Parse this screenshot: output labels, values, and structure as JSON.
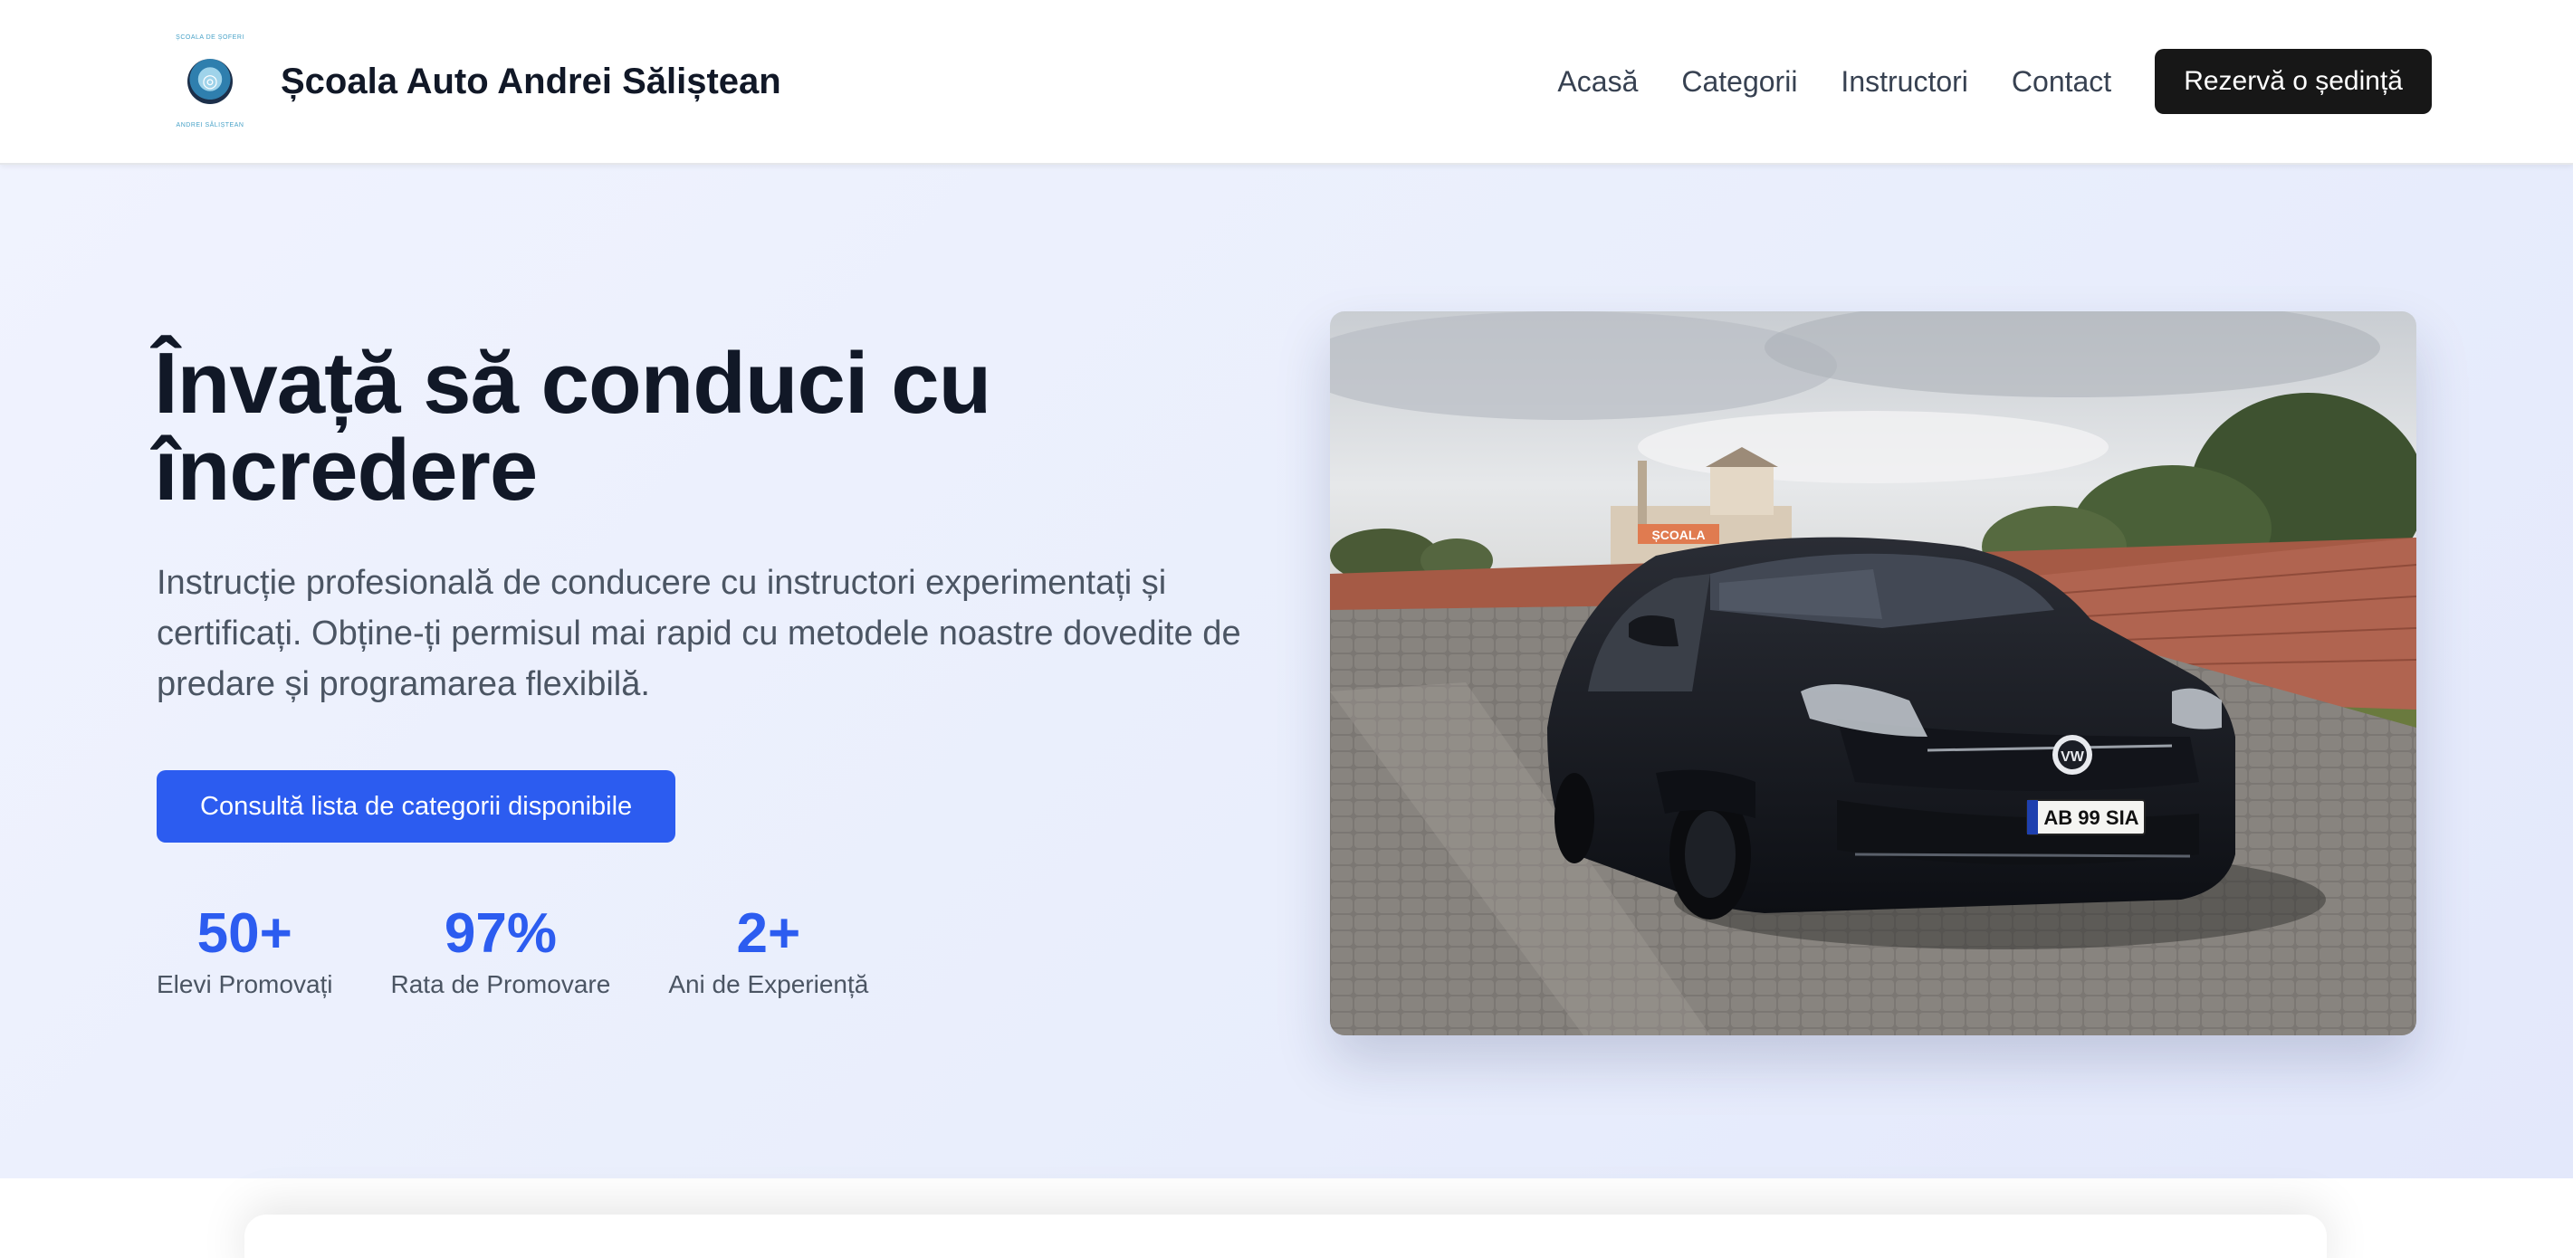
{
  "header": {
    "logo_text_top": "ȘCOALA DE ȘOFERI",
    "logo_text_bottom": "ANDREI SĂLIȘTEAN",
    "brand_name": "Școala Auto Andrei Săliștean",
    "nav": [
      {
        "label": "Acasă"
      },
      {
        "label": "Categorii"
      },
      {
        "label": "Instructori"
      },
      {
        "label": "Contact"
      }
    ],
    "cta_label": "Rezervă o ședință"
  },
  "hero": {
    "title": "Învață să conduci cu încredere",
    "description": "Instrucție profesională de conducere cu instructori experimentați și certificați. Obține-ți permisul mai rapid cu metodele noastre dovedite de predare și programarea flexibilă.",
    "button_label": "Consultă lista de categorii disponibile",
    "stats": [
      {
        "value": "50+",
        "label": "Elevi Promovați"
      },
      {
        "value": "97%",
        "label": "Rata de Promovare"
      },
      {
        "value": "2+",
        "label": "Ani de Experiență"
      }
    ],
    "image": {
      "sign_text": "ȘCOALA",
      "plate_text": "AB 99 SIA"
    }
  },
  "colors": {
    "accent": "#2c5cf0",
    "cta_dark": "#171717",
    "hero_bg": "#e9eefc",
    "text_dark": "#111827",
    "text_muted": "#4b5563"
  }
}
